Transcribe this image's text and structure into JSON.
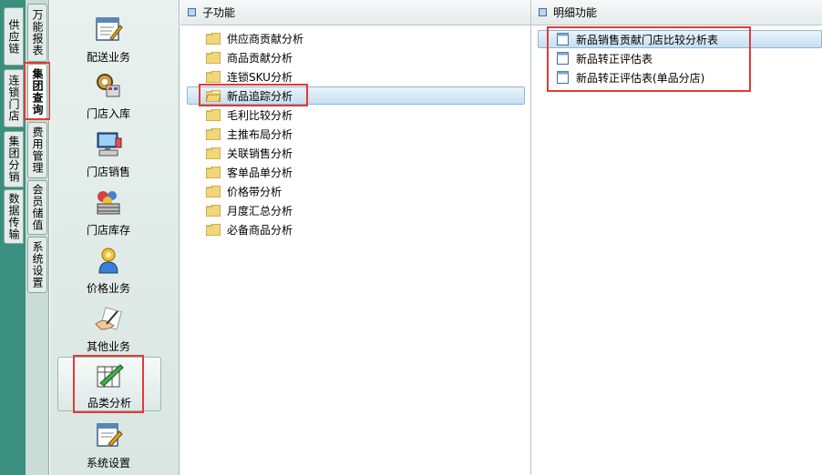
{
  "left_tabs": [
    {
      "label": "供应链"
    },
    {
      "label": "连锁门店"
    },
    {
      "label": "集团分销"
    },
    {
      "label": "数据传输"
    }
  ],
  "inner_tabs": [
    {
      "label": "万能报表"
    },
    {
      "label": "集团查询",
      "active": true
    },
    {
      "label": "费用管理"
    },
    {
      "label": "会员储值"
    },
    {
      "label": "系统设置"
    }
  ],
  "modules": [
    {
      "label": "配送业务",
      "icon": "delivery-icon"
    },
    {
      "label": "门店入库",
      "icon": "gear-stock-icon"
    },
    {
      "label": "门店销售",
      "icon": "pos-computer-icon"
    },
    {
      "label": "门店库存",
      "icon": "inventory-icon"
    },
    {
      "label": "价格业务",
      "icon": "person-price-icon"
    },
    {
      "label": "其他业务",
      "icon": "hand-pen-icon"
    },
    {
      "label": "品类分析",
      "icon": "category-analysis-icon",
      "selected": true
    },
    {
      "label": "系统设置",
      "icon": "system-settings-icon"
    }
  ],
  "sub_panel": {
    "title": "子功能",
    "items": [
      {
        "label": "供应商贡献分析"
      },
      {
        "label": "商品贡献分析"
      },
      {
        "label": "连锁SKU分析"
      },
      {
        "label": "新品追踪分析",
        "selected": true
      },
      {
        "label": "毛利比较分析"
      },
      {
        "label": "主推布局分析"
      },
      {
        "label": "关联销售分析"
      },
      {
        "label": "客单品单分析"
      },
      {
        "label": "价格带分析"
      },
      {
        "label": "月度汇总分析"
      },
      {
        "label": "必备商品分析"
      }
    ]
  },
  "detail_panel": {
    "title": "明细功能",
    "items": [
      {
        "label": "新品销售贡献门店比较分析表",
        "selected": true
      },
      {
        "label": "新品转正评估表"
      },
      {
        "label": "新品转正评估表(单品分店)"
      }
    ]
  },
  "colors": {
    "highlight": "#e53935",
    "tab_green": "#3b8f7e",
    "selection": "#c6dff1"
  }
}
